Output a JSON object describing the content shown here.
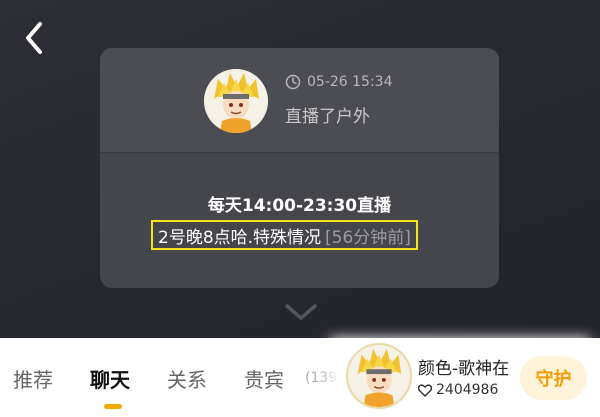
{
  "card": {
    "timestamp": "05-26 15:34",
    "status": "直播了户外",
    "schedule": "每天14:00-23:30直播",
    "notice": "2号晚8点哈.特殊情况",
    "notice_time": "[56分钟前]"
  },
  "tabs": [
    {
      "label": "推荐"
    },
    {
      "label": "聊天"
    },
    {
      "label": "关系"
    },
    {
      "label": "贵宾"
    }
  ],
  "tab_count": "(139",
  "host": {
    "name": "颜色-歌神在",
    "fans": "2404986",
    "guard_label": "守护"
  },
  "colors": {
    "accent": "#f2a900",
    "highlight_border": "#f4e21a",
    "guard_text": "#f39a00"
  }
}
